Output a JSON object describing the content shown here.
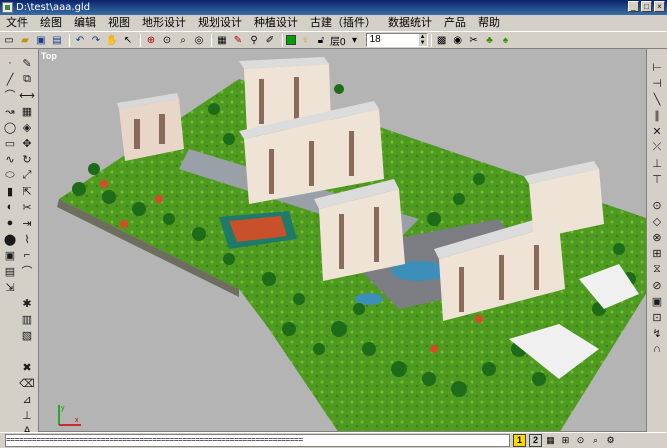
{
  "window": {
    "title": "D:\\test\\aaa.gld"
  },
  "menu": [
    "文件",
    "绘图",
    "编辑",
    "视图",
    "地形设计",
    "规划设计",
    "种植设计",
    "古建（插件）",
    "数据统计",
    "产品",
    "帮助"
  ],
  "toolbar": {
    "layer_label": "层0",
    "size_value": "18",
    "color": "#00a000"
  },
  "viewport": {
    "label": "Top",
    "axis_x": "x",
    "axis_y": "y"
  },
  "status": {
    "command_line": "=====================================================================",
    "page_1": "1",
    "page_2": "2"
  },
  "icons": {
    "top_toolbar": [
      "new-file-icon",
      "open-file-icon",
      "save-icon",
      "save-all-icon",
      "undo-icon",
      "redo-icon",
      "pan-icon",
      "select-arrow-icon",
      "zoom-extents-icon",
      "zoom-window-icon",
      "zoom-icon",
      "layer-manager-icon",
      "copy-properties-icon",
      "match-icon",
      "lock-layer-icon",
      "eye-icon",
      "dropdown-icon",
      "render-icon",
      "camera-icon",
      "plant-icon",
      "tree-icon"
    ],
    "left_tools": [
      "point-icon",
      "line-icon",
      "arc-icon",
      "polyline-icon",
      "circle-icon",
      "rectangle-icon",
      "spline-icon",
      "ellipse-icon",
      "fill-icon",
      "hatch-icon",
      "text-icon"
    ],
    "right_tools": [
      "snap-endpoint-icon",
      "snap-midpoint-icon",
      "snap-center-icon",
      "snap-intersection-icon",
      "snap-perpendicular-icon",
      "snap-tangent-icon",
      "snap-nearest-icon",
      "magnet-icon"
    ]
  }
}
